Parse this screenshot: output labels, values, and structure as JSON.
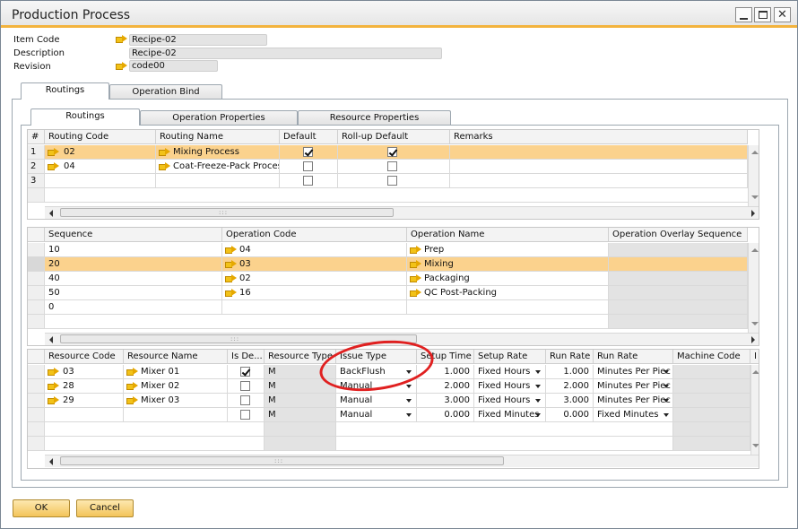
{
  "window": {
    "title": "Production Process"
  },
  "header": {
    "item_code_label": "Item Code",
    "item_code": "Recipe-02",
    "description_label": "Description",
    "description": "Recipe-02",
    "revision_label": "Revision",
    "revision": "code00"
  },
  "outer_tabs": [
    "Routings",
    "Operation Bind"
  ],
  "inner_tabs": [
    "Routings",
    "Operation Properties",
    "Resource Properties"
  ],
  "routings": {
    "columns": [
      "#",
      "Routing Code",
      "Routing Name",
      "Default",
      "Roll-up Default",
      "Remarks"
    ],
    "rows": [
      {
        "num": "1",
        "code": "02",
        "name": "Mixing Process",
        "default": true,
        "rollup": true,
        "remarks": ""
      },
      {
        "num": "2",
        "code": "04",
        "name": "Coat-Freeze-Pack Process",
        "default": false,
        "rollup": false,
        "remarks": ""
      },
      {
        "num": "3",
        "code": "",
        "name": "",
        "default": false,
        "rollup": false,
        "remarks": ""
      }
    ]
  },
  "operations": {
    "columns": [
      "Sequence",
      "Operation Code",
      "Operation Name",
      "Operation Overlay Sequence"
    ],
    "rows": [
      {
        "seq": "10",
        "code": "04",
        "name": "Prep"
      },
      {
        "seq": "20",
        "code": "03",
        "name": "Mixing"
      },
      {
        "seq": "40",
        "code": "02",
        "name": "Packaging"
      },
      {
        "seq": "50",
        "code": "16",
        "name": "QC Post-Packing"
      },
      {
        "seq": "0",
        "code": "",
        "name": ""
      }
    ]
  },
  "resources": {
    "columns": [
      "Resource Code",
      "Resource Name",
      "Is De...",
      "Resource Type",
      "Issue Type",
      "Setup Time",
      "Setup Rate",
      "Run Rate",
      "Run Rate",
      "Machine Code",
      "I"
    ],
    "rows": [
      {
        "code": "03",
        "name": "Mixer 01",
        "is_default": true,
        "type": "M",
        "issue": "BackFlush",
        "setup_time": "1.000",
        "setup_rate": "Fixed Hours",
        "run_rate": "1.000",
        "run_rate_unit": "Minutes Per Piec"
      },
      {
        "code": "28",
        "name": "Mixer 02",
        "is_default": false,
        "type": "M",
        "issue": "Manual",
        "setup_time": "2.000",
        "setup_rate": "Fixed Hours",
        "run_rate": "2.000",
        "run_rate_unit": "Minutes Per Piec"
      },
      {
        "code": "29",
        "name": "Mixer 03",
        "is_default": false,
        "type": "M",
        "issue": "Manual",
        "setup_time": "3.000",
        "setup_rate": "Fixed Hours",
        "run_rate": "3.000",
        "run_rate_unit": "Minutes Per Piec"
      },
      {
        "code": "",
        "name": "",
        "is_default": false,
        "type": "M",
        "issue": "Manual",
        "setup_time": "0.000",
        "setup_rate": "Fixed Minutes",
        "run_rate": "0.000",
        "run_rate_unit": "Fixed Minutes"
      }
    ]
  },
  "buttons": {
    "ok": "OK",
    "cancel": "Cancel"
  },
  "colors": {
    "accent": "#f3b33d",
    "selected_row": "#fbd28d",
    "highlight_circle": "#e02020"
  },
  "icons": {
    "link_arrow": "yellow-link-arrow-icon"
  }
}
